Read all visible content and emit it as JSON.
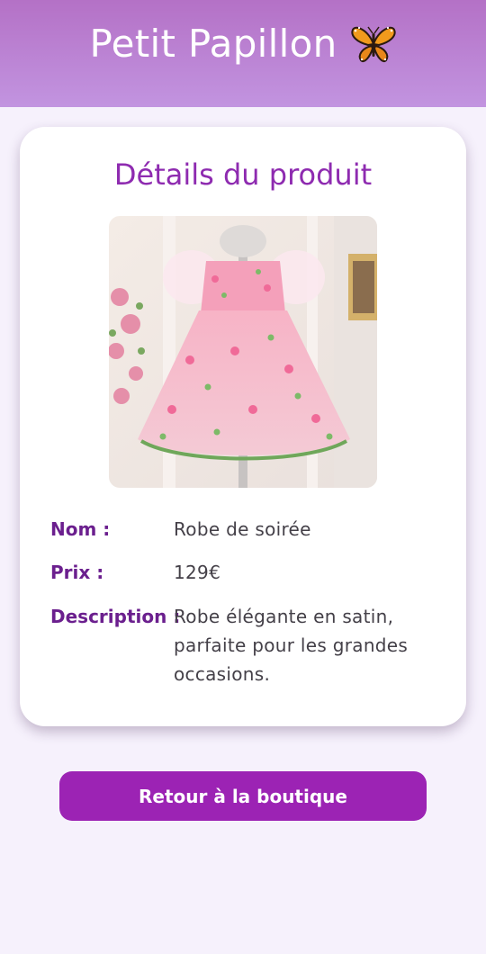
{
  "header": {
    "title": "Petit Papillon",
    "logo_icon": "butterfly-icon",
    "background_gradient": [
      "#b471c6",
      "#c294e0"
    ]
  },
  "product": {
    "section_title": "Détails du produit",
    "image_subject": "dress-photo",
    "fields": [
      {
        "label": "Nom :",
        "value": "Robe de soirée"
      },
      {
        "label": "Prix :",
        "value": "129€"
      },
      {
        "label": "Description :",
        "value": "Robe élégante en satin, parfaite pour les grandes occasions."
      }
    ]
  },
  "actions": {
    "back_label": "Retour à la boutique"
  },
  "colors": {
    "accent": "#9c23b4",
    "title": "#8e2bb0",
    "label": "#6b1f8e",
    "page_bg": "#f6f1fc"
  }
}
